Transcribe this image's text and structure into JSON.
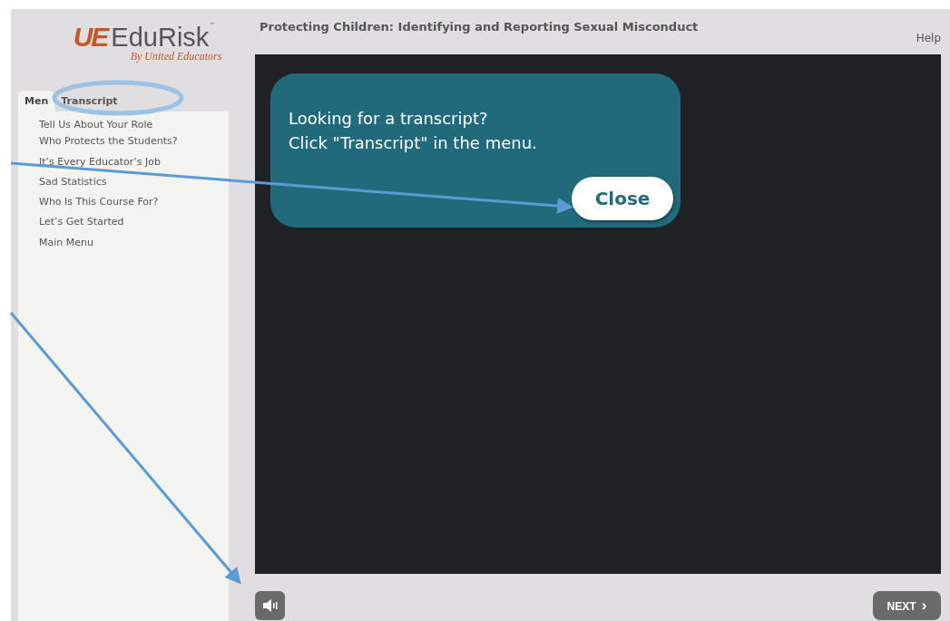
{
  "logo": {
    "mark": "UE",
    "name": "EduRisk",
    "trademark": "™",
    "tagline": "By United Educators"
  },
  "tabs": [
    {
      "label": "Men",
      "selected": true
    },
    {
      "label": "Transcript",
      "selected": false
    }
  ],
  "menu_items": [
    "Tell Us About Your Role",
    "Who Protects the Students?",
    "It’s Every Educator’s Job",
    "Sad Statistics",
    "Who Is This Course For?",
    "Let’s Get Started",
    "Main Menu"
  ],
  "course_title": "Protecting Children: Identifying and Reporting Sexual Misconduct",
  "help_link": "Help",
  "popup": {
    "lines": [
      "Looking for a transcript?",
      "Click \"Transcript\" in the menu."
    ],
    "button": "Close"
  },
  "next_button": "NEXT",
  "next_icon": "›"
}
